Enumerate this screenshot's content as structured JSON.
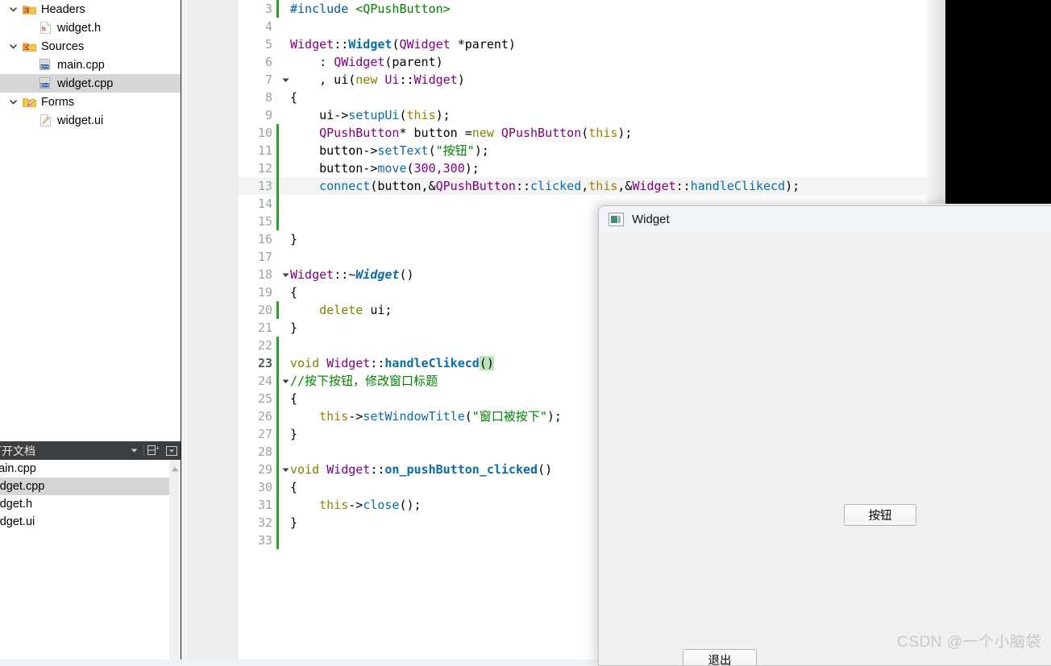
{
  "project_tree": {
    "items": [
      {
        "label": "Headers",
        "level": 1,
        "icon": "folder-h-icon",
        "arrow": "chevron-down-icon",
        "selected": false
      },
      {
        "label": "widget.h",
        "level": 2,
        "icon": "header-file-icon",
        "arrow": "",
        "selected": false
      },
      {
        "label": "Sources",
        "level": 1,
        "icon": "folder-cpp-icon",
        "arrow": "chevron-down-icon",
        "selected": false
      },
      {
        "label": "main.cpp",
        "level": 2,
        "icon": "cpp-file-icon",
        "arrow": "",
        "selected": false
      },
      {
        "label": "widget.cpp",
        "level": 2,
        "icon": "cpp-file-icon",
        "arrow": "",
        "selected": true
      },
      {
        "label": "Forms",
        "level": 1,
        "icon": "folder-forms-icon",
        "arrow": "chevron-down-icon",
        "selected": false
      },
      {
        "label": "widget.ui",
        "level": 2,
        "icon": "ui-file-icon",
        "arrow": "",
        "selected": false
      }
    ]
  },
  "open_documents": {
    "title": "打开文档",
    "toolbar": [
      {
        "name": "dropdown-icon",
        "label": "▾"
      },
      {
        "name": "split-add-icon",
        "label": "⊟+"
      },
      {
        "name": "close-panel-icon",
        "label": "▾"
      }
    ],
    "items": [
      {
        "label": "main.cpp",
        "selected": false
      },
      {
        "label": "widget.cpp",
        "selected": true
      },
      {
        "label": "widget.h",
        "selected": false
      },
      {
        "label": "widget.ui",
        "selected": false
      }
    ]
  },
  "editor": {
    "lines": [
      {
        "num": "3",
        "changed": true,
        "fold": "",
        "current": false,
        "highlight": false,
        "tokens": [
          {
            "t": "#include ",
            "c": "t-pre"
          },
          {
            "t": "<QPushButton>",
            "c": "t-inc"
          }
        ]
      },
      {
        "num": "4",
        "changed": false,
        "fold": "",
        "current": false,
        "highlight": false,
        "tokens": []
      },
      {
        "num": "5",
        "changed": false,
        "fold": "",
        "current": false,
        "highlight": false,
        "tokens": [
          {
            "t": "Widget",
            "c": "t-typ"
          },
          {
            "t": "::",
            "c": "t-pun"
          },
          {
            "t": "Widget",
            "c": "t-fn"
          },
          {
            "t": "(",
            "c": "t-pun"
          },
          {
            "t": "QWidget",
            "c": "t-typ"
          },
          {
            "t": " *parent)",
            "c": "t-pun"
          }
        ]
      },
      {
        "num": "6",
        "changed": false,
        "fold": "",
        "current": false,
        "highlight": false,
        "tokens": [
          {
            "t": "    : ",
            "c": "t-pun"
          },
          {
            "t": "QWidget",
            "c": "t-typ"
          },
          {
            "t": "(parent)",
            "c": "t-pun"
          }
        ]
      },
      {
        "num": "7",
        "changed": false,
        "fold": "chevron-down-icon",
        "current": false,
        "highlight": false,
        "tokens": [
          {
            "t": "    , ui(",
            "c": "t-pun"
          },
          {
            "t": "new",
            "c": "t-kw"
          },
          {
            "t": " ",
            "c": "t-pun"
          },
          {
            "t": "Ui",
            "c": "t-typ"
          },
          {
            "t": "::",
            "c": "t-pun"
          },
          {
            "t": "Widget",
            "c": "t-typ"
          },
          {
            "t": ")",
            "c": "t-pun"
          }
        ]
      },
      {
        "num": "8",
        "changed": false,
        "fold": "",
        "current": false,
        "highlight": false,
        "tokens": [
          {
            "t": "{",
            "c": "t-pun"
          }
        ]
      },
      {
        "num": "9",
        "changed": false,
        "fold": "",
        "current": false,
        "highlight": false,
        "tokens": [
          {
            "t": "    ui->",
            "c": "t-pun"
          },
          {
            "t": "setupUi",
            "c": "t-mem"
          },
          {
            "t": "(",
            "c": "t-pun"
          },
          {
            "t": "this",
            "c": "t-this"
          },
          {
            "t": ");",
            "c": "t-pun"
          }
        ]
      },
      {
        "num": "10",
        "changed": true,
        "fold": "",
        "current": false,
        "highlight": false,
        "tokens": [
          {
            "t": "    ",
            "c": "t-pun"
          },
          {
            "t": "QPushButton",
            "c": "t-typ"
          },
          {
            "t": "* button =",
            "c": "t-pun"
          },
          {
            "t": "new",
            "c": "t-kw"
          },
          {
            "t": " ",
            "c": "t-pun"
          },
          {
            "t": "QPushButton",
            "c": "t-typ"
          },
          {
            "t": "(",
            "c": "t-pun"
          },
          {
            "t": "this",
            "c": "t-this"
          },
          {
            "t": ");",
            "c": "t-pun"
          }
        ]
      },
      {
        "num": "11",
        "changed": true,
        "fold": "",
        "current": false,
        "highlight": false,
        "tokens": [
          {
            "t": "    button->",
            "c": "t-pun"
          },
          {
            "t": "setText",
            "c": "t-mem"
          },
          {
            "t": "(",
            "c": "t-pun"
          },
          {
            "t": "\"按钮\"",
            "c": "t-str"
          },
          {
            "t": ");",
            "c": "t-pun"
          }
        ]
      },
      {
        "num": "12",
        "changed": true,
        "fold": "",
        "current": false,
        "highlight": false,
        "tokens": [
          {
            "t": "    button->",
            "c": "t-pun"
          },
          {
            "t": "move",
            "c": "t-mem"
          },
          {
            "t": "(",
            "c": "t-pun"
          },
          {
            "t": "300,300",
            "c": "t-typ"
          },
          {
            "t": ");",
            "c": "t-pun"
          }
        ]
      },
      {
        "num": "13",
        "changed": true,
        "fold": "",
        "current": false,
        "highlight": true,
        "tokens": [
          {
            "t": "    ",
            "c": "t-pun"
          },
          {
            "t": "connect",
            "c": "t-mem"
          },
          {
            "t": "(button,&",
            "c": "t-pun"
          },
          {
            "t": "QPushButton",
            "c": "t-typ"
          },
          {
            "t": "::",
            "c": "t-pun"
          },
          {
            "t": "clicked",
            "c": "t-mem"
          },
          {
            "t": ",",
            "c": "t-pun"
          },
          {
            "t": "this",
            "c": "t-this"
          },
          {
            "t": ",&",
            "c": "t-pun"
          },
          {
            "t": "Widget",
            "c": "t-typ"
          },
          {
            "t": "::",
            "c": "t-pun"
          },
          {
            "t": "handleClikecd",
            "c": "t-mem"
          },
          {
            "t": ");",
            "c": "t-pun"
          }
        ]
      },
      {
        "num": "14",
        "changed": true,
        "fold": "",
        "current": false,
        "highlight": false,
        "tokens": []
      },
      {
        "num": "15",
        "changed": true,
        "fold": "",
        "current": false,
        "highlight": false,
        "tokens": []
      },
      {
        "num": "16",
        "changed": false,
        "fold": "",
        "current": false,
        "highlight": false,
        "tokens": [
          {
            "t": "}",
            "c": "t-pun"
          }
        ]
      },
      {
        "num": "17",
        "changed": false,
        "fold": "",
        "current": false,
        "highlight": false,
        "tokens": []
      },
      {
        "num": "18",
        "changed": false,
        "fold": "chevron-down-icon",
        "current": false,
        "highlight": false,
        "tokens": [
          {
            "t": "Widget",
            "c": "t-typ"
          },
          {
            "t": "::~",
            "c": "t-pun"
          },
          {
            "t": "Widget",
            "c": "t-fni"
          },
          {
            "t": "()",
            "c": "t-pun"
          }
        ]
      },
      {
        "num": "19",
        "changed": false,
        "fold": "",
        "current": false,
        "highlight": false,
        "tokens": [
          {
            "t": "{",
            "c": "t-pun"
          }
        ]
      },
      {
        "num": "20",
        "changed": true,
        "fold": "",
        "current": false,
        "highlight": false,
        "tokens": [
          {
            "t": "    ",
            "c": "t-pun"
          },
          {
            "t": "delete",
            "c": "t-kw"
          },
          {
            "t": " ui;",
            "c": "t-pun"
          }
        ]
      },
      {
        "num": "21",
        "changed": false,
        "fold": "",
        "current": false,
        "highlight": false,
        "tokens": [
          {
            "t": "}",
            "c": "t-pun"
          }
        ]
      },
      {
        "num": "22",
        "changed": true,
        "fold": "",
        "current": false,
        "highlight": false,
        "tokens": []
      },
      {
        "num": "23",
        "changed": true,
        "fold": "",
        "current": true,
        "highlight": false,
        "tokens": [
          {
            "t": "void",
            "c": "t-kw"
          },
          {
            "t": " ",
            "c": "t-pun"
          },
          {
            "t": "Widget",
            "c": "t-typ"
          },
          {
            "t": "::",
            "c": "t-pun"
          },
          {
            "t": "handleClikecd",
            "c": "t-fn"
          },
          {
            "t": "()",
            "c": "t-par-hl"
          }
        ]
      },
      {
        "num": "24",
        "changed": true,
        "fold": "chevron-down-icon",
        "current": false,
        "highlight": false,
        "tokens": [
          {
            "t": "//按下按钮，修改窗口标题",
            "c": "t-cmt"
          }
        ]
      },
      {
        "num": "25",
        "changed": true,
        "fold": "",
        "current": false,
        "highlight": false,
        "tokens": [
          {
            "t": "{",
            "c": "t-pun"
          }
        ]
      },
      {
        "num": "26",
        "changed": true,
        "fold": "",
        "current": false,
        "highlight": false,
        "tokens": [
          {
            "t": "    ",
            "c": "t-pun"
          },
          {
            "t": "this",
            "c": "t-this"
          },
          {
            "t": "->",
            "c": "t-pun"
          },
          {
            "t": "setWindowTitle",
            "c": "t-mem"
          },
          {
            "t": "(",
            "c": "t-pun"
          },
          {
            "t": "\"窗口被按下\"",
            "c": "t-str"
          },
          {
            "t": ");",
            "c": "t-pun"
          }
        ]
      },
      {
        "num": "27",
        "changed": true,
        "fold": "",
        "current": false,
        "highlight": false,
        "tokens": [
          {
            "t": "}",
            "c": "t-pun"
          }
        ]
      },
      {
        "num": "28",
        "changed": true,
        "fold": "",
        "current": false,
        "highlight": false,
        "tokens": []
      },
      {
        "num": "29",
        "changed": true,
        "fold": "chevron-down-icon",
        "current": false,
        "highlight": false,
        "tokens": [
          {
            "t": "void",
            "c": "t-kw"
          },
          {
            "t": " ",
            "c": "t-pun"
          },
          {
            "t": "Widget",
            "c": "t-typ"
          },
          {
            "t": "::",
            "c": "t-pun"
          },
          {
            "t": "on_pushButton_clicked",
            "c": "t-fn"
          },
          {
            "t": "()",
            "c": "t-pun"
          }
        ]
      },
      {
        "num": "30",
        "changed": true,
        "fold": "",
        "current": false,
        "highlight": false,
        "tokens": [
          {
            "t": "{",
            "c": "t-pun"
          }
        ]
      },
      {
        "num": "31",
        "changed": true,
        "fold": "",
        "current": false,
        "highlight": false,
        "tokens": [
          {
            "t": "    ",
            "c": "t-pun"
          },
          {
            "t": "this",
            "c": "t-this"
          },
          {
            "t": "->",
            "c": "t-pun"
          },
          {
            "t": "close",
            "c": "t-mem"
          },
          {
            "t": "();",
            "c": "t-pun"
          }
        ]
      },
      {
        "num": "32",
        "changed": true,
        "fold": "",
        "current": false,
        "highlight": false,
        "tokens": [
          {
            "t": "}",
            "c": "t-pun"
          }
        ]
      },
      {
        "num": "33",
        "changed": true,
        "fold": "",
        "current": false,
        "highlight": false,
        "tokens": []
      }
    ]
  },
  "widget_window": {
    "title": "Widget",
    "icon": "qt-widget-icon",
    "buttons": [
      {
        "name": "anniu-button",
        "label": "按钮"
      },
      {
        "name": "tuichu-button",
        "label": "退出"
      }
    ]
  },
  "watermark": {
    "text": "CSDN @一个小脑袋"
  },
  "colors": {
    "accent_green": "#2d9e2d",
    "selection_gray": "#d6d6d6",
    "panel_dark": "#3c3f41",
    "editor_bg": "#ffffff",
    "gutter_bg": "#eeeeee",
    "desktop_bg": "#eef1f6",
    "qt_icon_green": "#3f8f73"
  }
}
